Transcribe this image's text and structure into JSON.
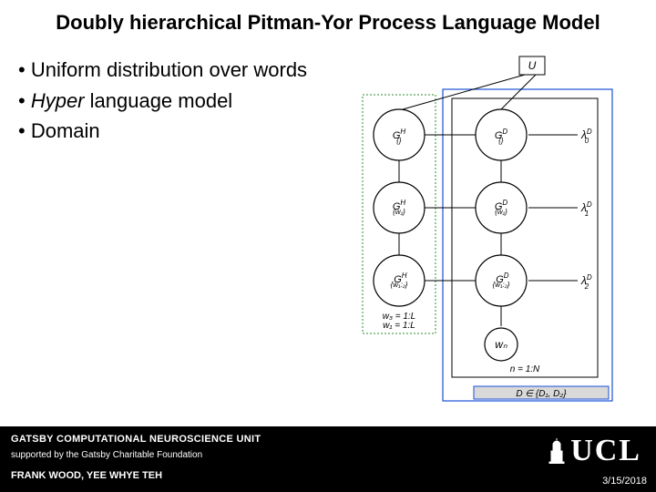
{
  "title": "Doubly hierarchical Pitman-Yor Process Language Model",
  "bullets": {
    "b1": "Uniform distribution over words",
    "b2_prefix": "Hyper",
    "b2_suffix": " language model",
    "b3": "Domain"
  },
  "diagram": {
    "top_box": "U",
    "left_col": [
      "G_{}^H",
      "G_{w1}^H",
      "G_{w1:2}^H"
    ],
    "right_col": [
      "G_{}^D",
      "G_{w1}^D",
      "G_{w1:2}^D"
    ],
    "lambdas": [
      "λ_0^D",
      "λ_1^D",
      "λ_2^D"
    ],
    "left_obs": "w_3 = 1:L",
    "left_plate": "w_1 = 1:L",
    "obs_node": "w_n",
    "n_plate": "n = 1:N",
    "d_plate": "D ∈ {D_1, D_2}"
  },
  "footer": {
    "line1": "GATSBY COMPUTATIONAL NEUROSCIENCE UNIT",
    "line2": "supported by the Gatsby Charitable Foundation",
    "line3": "FRANK WOOD, YEE WHYE TEH",
    "date": "3/15/2018",
    "logo": "UCL"
  }
}
